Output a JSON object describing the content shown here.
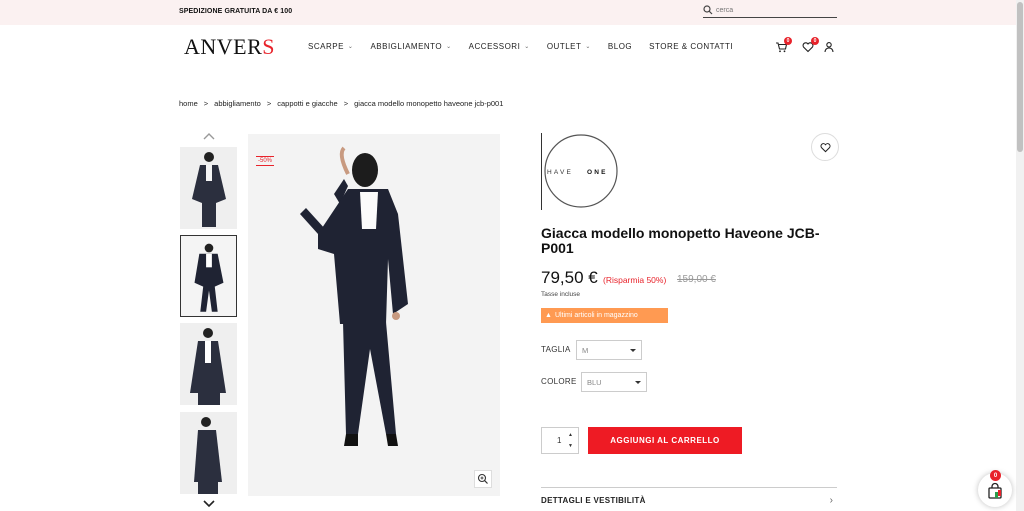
{
  "topbar": {
    "shipping": "SPEDIZIONE GRATUITA DA € 100",
    "search_placeholder": "cerca"
  },
  "brand": {
    "logo_main": "ANVER",
    "logo_accent": "S",
    "accent_color": "#e8232b"
  },
  "nav": {
    "items": [
      {
        "label": "SCARPE",
        "has_dropdown": true
      },
      {
        "label": "ABBIGLIAMENTO",
        "has_dropdown": true
      },
      {
        "label": "ACCESSORI",
        "has_dropdown": true
      },
      {
        "label": "OUTLET",
        "has_dropdown": true
      },
      {
        "label": "BLOG",
        "has_dropdown": false
      },
      {
        "label": "STORE & CONTATTI",
        "has_dropdown": false
      }
    ],
    "cart_count": "0",
    "wishlist_count": "0"
  },
  "breadcrumb": {
    "items": [
      "home",
      "abbigliamento",
      "cappotti e giacche",
      "giacca modello monopetto haveone jcb-p001"
    ]
  },
  "gallery": {
    "discount_badge": "-50%",
    "thumb_count": 4,
    "selected_thumb": 2
  },
  "product": {
    "brand_logo_text_a": "HAVE",
    "brand_logo_text_b": "ONE",
    "title": "Giacca modello monopetto Haveone JCB-P001",
    "price": "79,50 €",
    "saving": "(Risparmia 50%)",
    "old_price": "159,00 €",
    "tax_note": "Tasse incluse",
    "stock_note": "Ultimi articoli in magazzino",
    "size_label": "TAGLIA",
    "size_value": "M",
    "color_label": "COLORE",
    "color_value": "BLU",
    "quantity": "1",
    "add_to_cart": "AGGIUNGI AL CARRELLO",
    "details_label": "DETTAGLI E VESTIBILITÀ"
  },
  "floating_cart": {
    "count": "0"
  }
}
